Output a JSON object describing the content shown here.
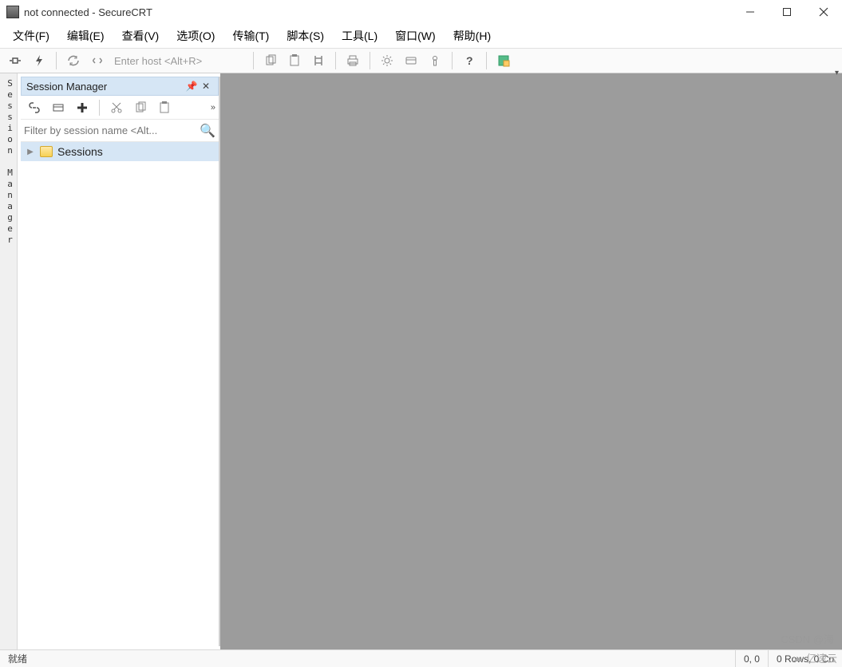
{
  "window": {
    "title": "not connected - SecureCRT"
  },
  "menu": {
    "file": "文件(F)",
    "edit": "编辑(E)",
    "view": "查看(V)",
    "options": "选项(O)",
    "transfer": "传输(T)",
    "script": "脚本(S)",
    "tools": "工具(L)",
    "window": "窗口(W)",
    "help": "帮助(H)"
  },
  "toolbar": {
    "host_placeholder": "Enter host <Alt+R>"
  },
  "session_panel": {
    "title": "Session Manager",
    "filter_placeholder": "Filter by session name <Alt...",
    "root": "Sessions"
  },
  "vtab": "Session Manager",
  "status": {
    "ready": "就绪",
    "pos": "0, 0",
    "rows": "0 Rows, 0 Co"
  },
  "watermark": "CSDN @海",
  "cloud": "亿速云"
}
